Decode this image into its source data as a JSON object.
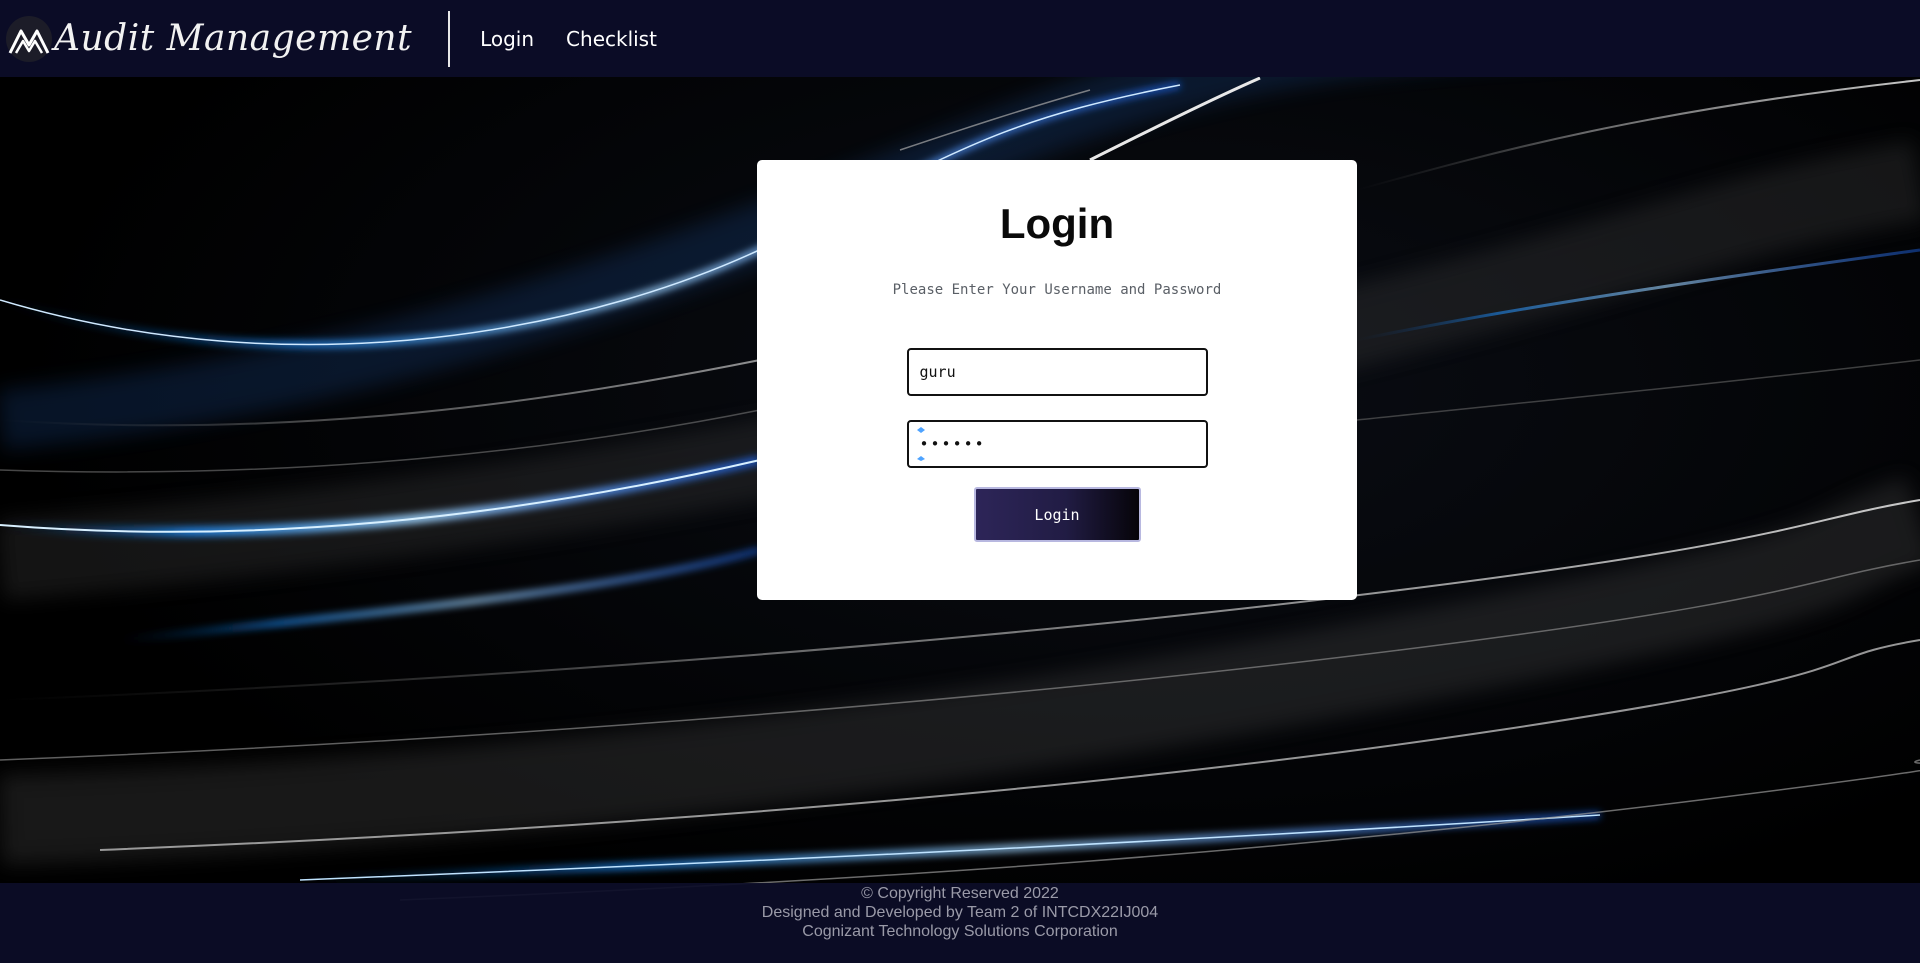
{
  "navbar": {
    "brand_name": "Audit Management",
    "links": [
      {
        "label": "Login"
      },
      {
        "label": "Checklist"
      }
    ]
  },
  "login_card": {
    "title": "Login",
    "subtitle": "Please Enter Your Username and Password",
    "username_value": "guru",
    "password_value": "••••••",
    "submit_label": "Login"
  },
  "footer": {
    "line1": "© Copyright Reserved 2022",
    "line2": "Designed and Developed by Team 2 of INTCDX22IJ004",
    "line3": "Cognizant Technology Solutions Corporation"
  },
  "colors": {
    "navbar_bg": "#0b0c26",
    "accent_blue": "#1e90ff",
    "button_gradient_start": "#2d2558",
    "button_gradient_end": "#060409"
  },
  "icons": {
    "logo": "mountain-logo-icon",
    "password_manager": "key-icon"
  }
}
